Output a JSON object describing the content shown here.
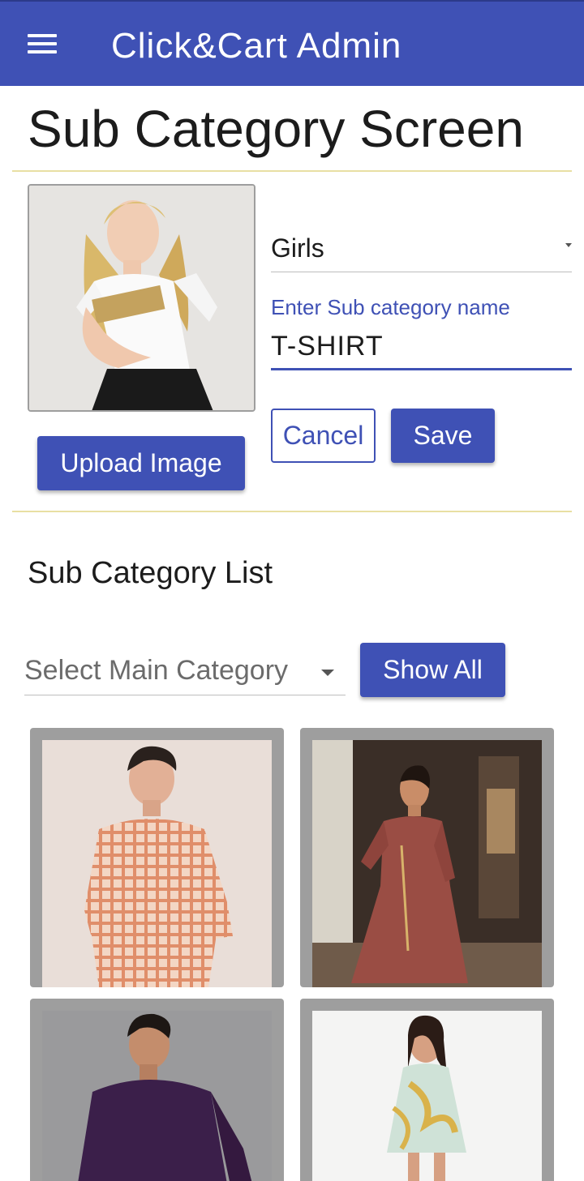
{
  "app_bar": {
    "title": "Click&Cart Admin",
    "menu_icon": "hamburger-menu-icon",
    "color": "#3f51b5"
  },
  "form": {
    "title": "Sub Category Screen",
    "upload_label": "Upload Image",
    "category_select": {
      "value": "Girls"
    },
    "subcategory_input": {
      "label": "Enter Sub category name",
      "value": "T-SHIRT"
    },
    "cancel_label": "Cancel",
    "save_label": "Save"
  },
  "list": {
    "title": "Sub Category List",
    "filter_placeholder": "Select Main Category",
    "show_all_label": "Show All",
    "items": [
      {
        "image": "man-checked-shirt"
      },
      {
        "image": "woman-kurta-dress"
      },
      {
        "image": "man-purple-shirt"
      },
      {
        "image": "girl-floral-dress"
      }
    ]
  },
  "colors": {
    "primary": "#3f51b5",
    "divider": "#e8dfa3",
    "card_border": "#9e9e9e"
  }
}
